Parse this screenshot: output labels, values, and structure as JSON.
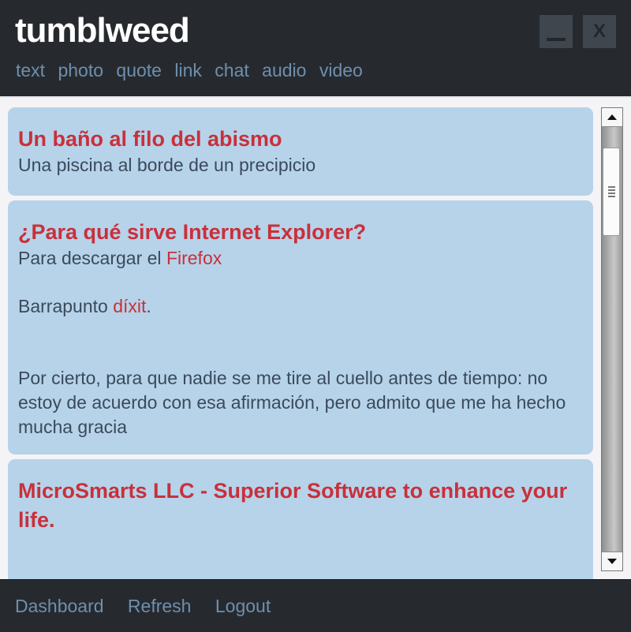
{
  "app": {
    "title": "tumblweed",
    "window_controls": {
      "minimize": "_",
      "close": "X"
    }
  },
  "post_types": [
    "text",
    "photo",
    "quote",
    "link",
    "chat",
    "audio",
    "video"
  ],
  "posts": [
    {
      "title": "Un baño al filo del abismo",
      "body": "Una piscina al borde de un precipicio"
    },
    {
      "title": "¿Para qué sirve Internet Explorer?",
      "line1_prefix": "Para descargar el ",
      "line1_link": "Firefox",
      "line2_prefix": "Barrapunto ",
      "line2_link": "díxit",
      "line2_suffix": ".",
      "paragraph": "Por cierto, para que nadie se me tire al cuello antes de tiempo: no estoy de acuerdo con esa afirmación, pero admito que me ha hecho mucha gracia"
    },
    {
      "title": "MicroSmarts LLC - Superior Software to enhance your life."
    }
  ],
  "footer": {
    "links": [
      "Dashboard",
      "Refresh",
      "Logout"
    ]
  },
  "colors": {
    "header_bg": "#262a2f",
    "post_bg": "#b6d3ea",
    "title_red": "#c9303a",
    "nav_link": "#6f8fad"
  }
}
